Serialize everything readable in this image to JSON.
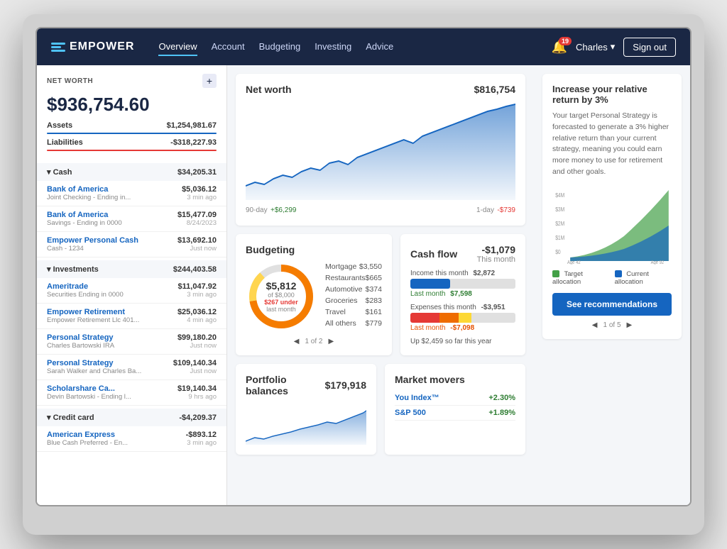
{
  "nav": {
    "logo_text": "EMPOWER",
    "links": [
      {
        "label": "Overview",
        "active": true
      },
      {
        "label": "Account",
        "active": false
      },
      {
        "label": "Budgeting",
        "active": false
      },
      {
        "label": "Investing",
        "active": false
      },
      {
        "label": "Advice",
        "active": false
      }
    ],
    "bell_count": "19",
    "user": "Charles",
    "signout": "Sign out"
  },
  "sidebar": {
    "net_worth_label": "NET WORTH",
    "net_worth_value": "$936,754.60",
    "assets_label": "Assets",
    "assets_value": "$1,254,981.67",
    "liabilities_label": "Liabilities",
    "liabilities_value": "-$318,227.93",
    "sections": [
      {
        "label": "Cash",
        "amount": "$34,205.31",
        "accounts": [
          {
            "name": "Bank of America",
            "amount": "$5,036.12",
            "desc": "Joint Checking - Ending in...",
            "time": "3 min ago"
          },
          {
            "name": "Bank of America",
            "amount": "$15,477.09",
            "desc": "Savings - Ending in 0000",
            "time": "8/24/2023"
          },
          {
            "name": "Empower Personal Cash",
            "amount": "$13,692.10",
            "desc": "Cash - 1234",
            "time": "Just now"
          }
        ]
      },
      {
        "label": "Investments",
        "amount": "$244,403.58",
        "accounts": [
          {
            "name": "Ameritrade",
            "amount": "$11,047.92",
            "desc": "Securities Ending in 0000",
            "time": "3 min ago"
          },
          {
            "name": "Empower Retirement",
            "amount": "$25,036.12",
            "desc": "Empower Retirement Llc 401...",
            "time": "4 min ago"
          },
          {
            "name": "Personal Strategy",
            "amount": "$99,180.20",
            "desc": "Charles Bartowski IRA",
            "time": "Just now"
          },
          {
            "name": "Personal Strategy",
            "amount": "$109,140.34",
            "desc": "Sarah Walker and Charles Ba...",
            "time": "Just now"
          },
          {
            "name": "Scholarshare Ca...",
            "amount": "$19,140.34",
            "desc": "Devin Bartowski - Ending l...",
            "time": "9 hrs ago"
          }
        ]
      },
      {
        "label": "Credit card",
        "amount": "-$4,209.37",
        "accounts": [
          {
            "name": "American Express",
            "amount": "-$893.12",
            "desc": "Blue Cash Preferred - En...",
            "time": "3 min ago"
          }
        ]
      }
    ]
  },
  "net_worth_card": {
    "title": "Net worth",
    "value": "$816,754",
    "period_90": "90-day",
    "change_90": "+$6,299",
    "period_1": "1-day",
    "change_1": "-$739"
  },
  "budgeting_card": {
    "title": "Budgeting",
    "donut_amount": "$5,812",
    "donut_of": "of $8,000",
    "donut_under": "$267 under",
    "donut_sub": "last month",
    "page_info": "1 of 2",
    "items": [
      {
        "label": "Mortgage",
        "value": "$3,550"
      },
      {
        "label": "Restaurants",
        "value": "$665"
      },
      {
        "label": "Automotive",
        "value": "$374"
      },
      {
        "label": "Groceries",
        "value": "$283"
      },
      {
        "label": "Travel",
        "value": "$161"
      },
      {
        "label": "All others",
        "value": "$779"
      }
    ]
  },
  "cashflow_card": {
    "title": "Cash flow",
    "value": "-$1,079",
    "period": "This month",
    "income_label": "Income this month",
    "income_value": "$2,872",
    "income_last_label": "Last month",
    "income_last_value": "$7,598",
    "expenses_label": "Expenses this month",
    "expenses_value": "-$3,951",
    "expenses_last_label": "Last month",
    "expenses_last_value": "-$7,098",
    "year_note": "Up $2,459 so far this year"
  },
  "right_panel": {
    "increase_title": "Increase your relative return by 3%",
    "increase_desc": "Your target Personal Strategy is forecasted to generate a 3% higher relative return than your current strategy, meaning you could earn more money to use for retirement and other goals.",
    "age_start": "Age 42",
    "age_end": "Age 92",
    "legend_target": "Target allocation",
    "legend_current": "Current allocation",
    "recommendations_btn": "See recommendations",
    "pagination": "1 of 5"
  },
  "portfolio_card": {
    "title": "Portfolio balances",
    "value": "$179,918"
  },
  "market_movers_card": {
    "title": "Market movers",
    "movers": [
      {
        "name": "You Index™",
        "change": "+2.30%",
        "positive": true
      },
      {
        "name": "S&P 500",
        "change": "+1.89%",
        "positive": true
      }
    ]
  }
}
